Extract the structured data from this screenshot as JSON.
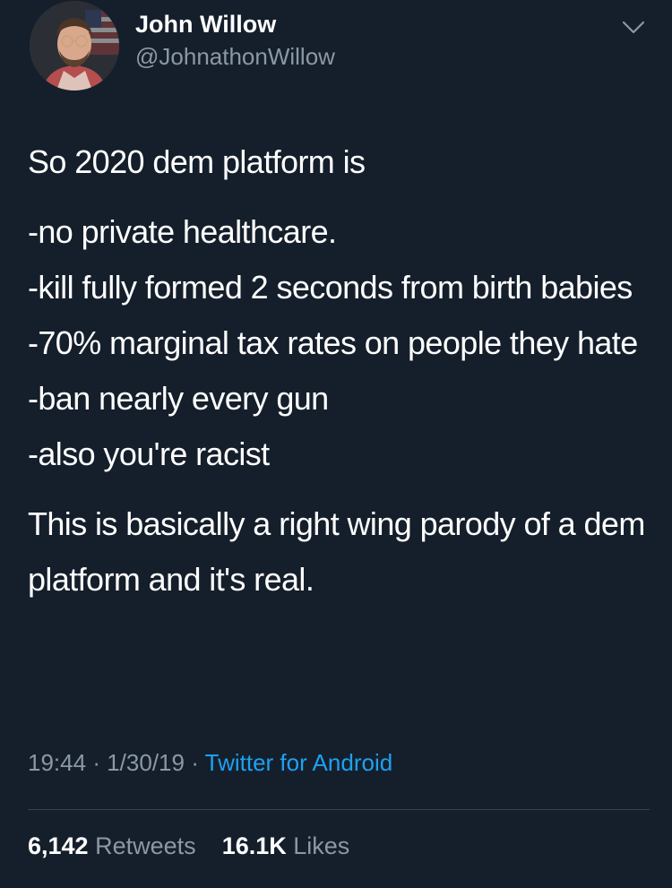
{
  "author": {
    "display_name": "John Willow",
    "handle": "@JohnathonWillow",
    "avatar_icon": "user-avatar-photo"
  },
  "menu_icon": "chevron-down-icon",
  "tweet": {
    "intro": "So 2020 dem platform is",
    "points": [
      "-no private healthcare.",
      "-kill fully formed 2 seconds from birth babies",
      "-70% marginal tax rates on people they hate",
      "-ban nearly every gun",
      "-also you're racist"
    ],
    "closing": "This is basically a right wing parody of a dem platform and it's real."
  },
  "meta": {
    "time": "19:44",
    "separator": "·",
    "date": "1/30/19",
    "source": "Twitter for Android"
  },
  "stats": {
    "retweets_count": "6,142",
    "retweets_label": "Retweets",
    "likes_count": "16.1K",
    "likes_label": "Likes"
  },
  "colors": {
    "background": "#151f2b",
    "secondary_text": "#8b98a5",
    "link": "#1da1f2",
    "divider": "#38444d"
  }
}
